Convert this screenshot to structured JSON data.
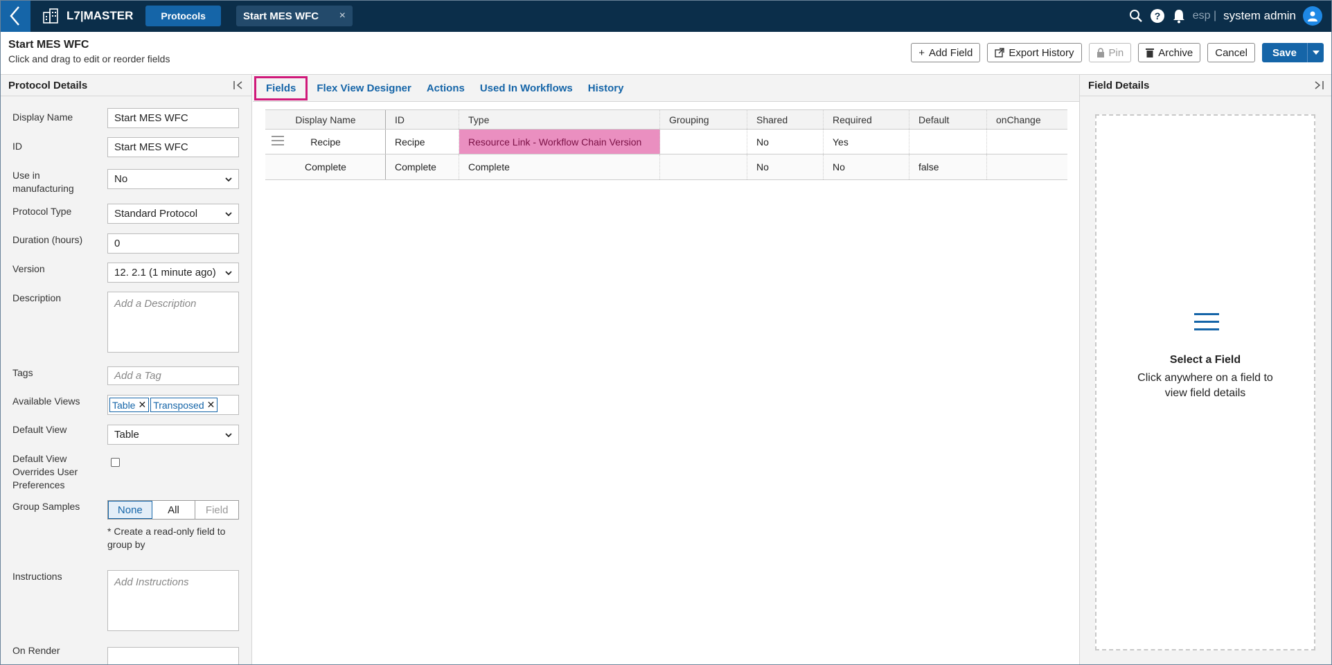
{
  "app": {
    "brand": "L7|MASTER",
    "nav_tab": "Protocols",
    "doc_tab": "Start MES WFC",
    "doc_tab_close": "×"
  },
  "topbar": {
    "tenant": "esp |",
    "user": "system admin"
  },
  "header": {
    "title": "Start MES WFC",
    "subtitle": "Click and drag to edit or reorder fields"
  },
  "toolbar": {
    "add_field": "Add Field",
    "export_history": "Export History",
    "pin": "Pin",
    "archive": "Archive",
    "cancel": "Cancel",
    "save": "Save"
  },
  "left_panel": {
    "title": "Protocol Details",
    "display_name": {
      "label": "Display Name",
      "value": "Start MES WFC"
    },
    "id": {
      "label": "ID",
      "value": "Start MES WFC"
    },
    "use_in_mfg": {
      "label": "Use in manufacturing",
      "value": "No"
    },
    "protocol_type": {
      "label": "Protocol Type",
      "value": "Standard Protocol"
    },
    "duration": {
      "label": "Duration (hours)",
      "value": "0"
    },
    "version": {
      "label": "Version",
      "value": "12. 2.1 (1 minute ago)"
    },
    "description": {
      "label": "Description",
      "placeholder": "Add a Description"
    },
    "tags": {
      "label": "Tags",
      "placeholder": "Add a Tag"
    },
    "available_views": {
      "label": "Available Views",
      "chips": [
        "Table",
        "Transposed"
      ]
    },
    "default_view": {
      "label": "Default View",
      "value": "Table"
    },
    "default_view_overrides": {
      "label": "Default View Overrides User Preferences",
      "checked": false
    },
    "group_samples": {
      "label": "Group Samples",
      "options": [
        "None",
        "All",
        "Field"
      ],
      "selected": "None",
      "note": "* Create a read-only field to group by"
    },
    "instructions": {
      "label": "Instructions",
      "placeholder": "Add Instructions"
    },
    "on_render": {
      "label": "On Render"
    }
  },
  "tabs": [
    "Fields",
    "Flex View Designer",
    "Actions",
    "Used In Workflows",
    "History"
  ],
  "grid": {
    "columns": [
      "Display Name",
      "ID",
      "Type",
      "Grouping",
      "Shared",
      "Required",
      "Default",
      "onChange"
    ],
    "rows": [
      [
        "Recipe",
        "Recipe",
        "Resource Link - Workflow Chain Version",
        "",
        "No",
        "Yes",
        "",
        ""
      ],
      [
        "Complete",
        "Complete",
        "Complete",
        "",
        "No",
        "No",
        "false",
        ""
      ]
    ]
  },
  "right_panel": {
    "title": "Field Details",
    "empty_title": "Select a Field",
    "empty_text": "Click anywhere on a field to view field details"
  },
  "colors": {
    "nav": "#0b2e4a",
    "accent": "#1565a8",
    "highlight": "#ea8fc0",
    "active_tab_border": "#d0197a"
  }
}
